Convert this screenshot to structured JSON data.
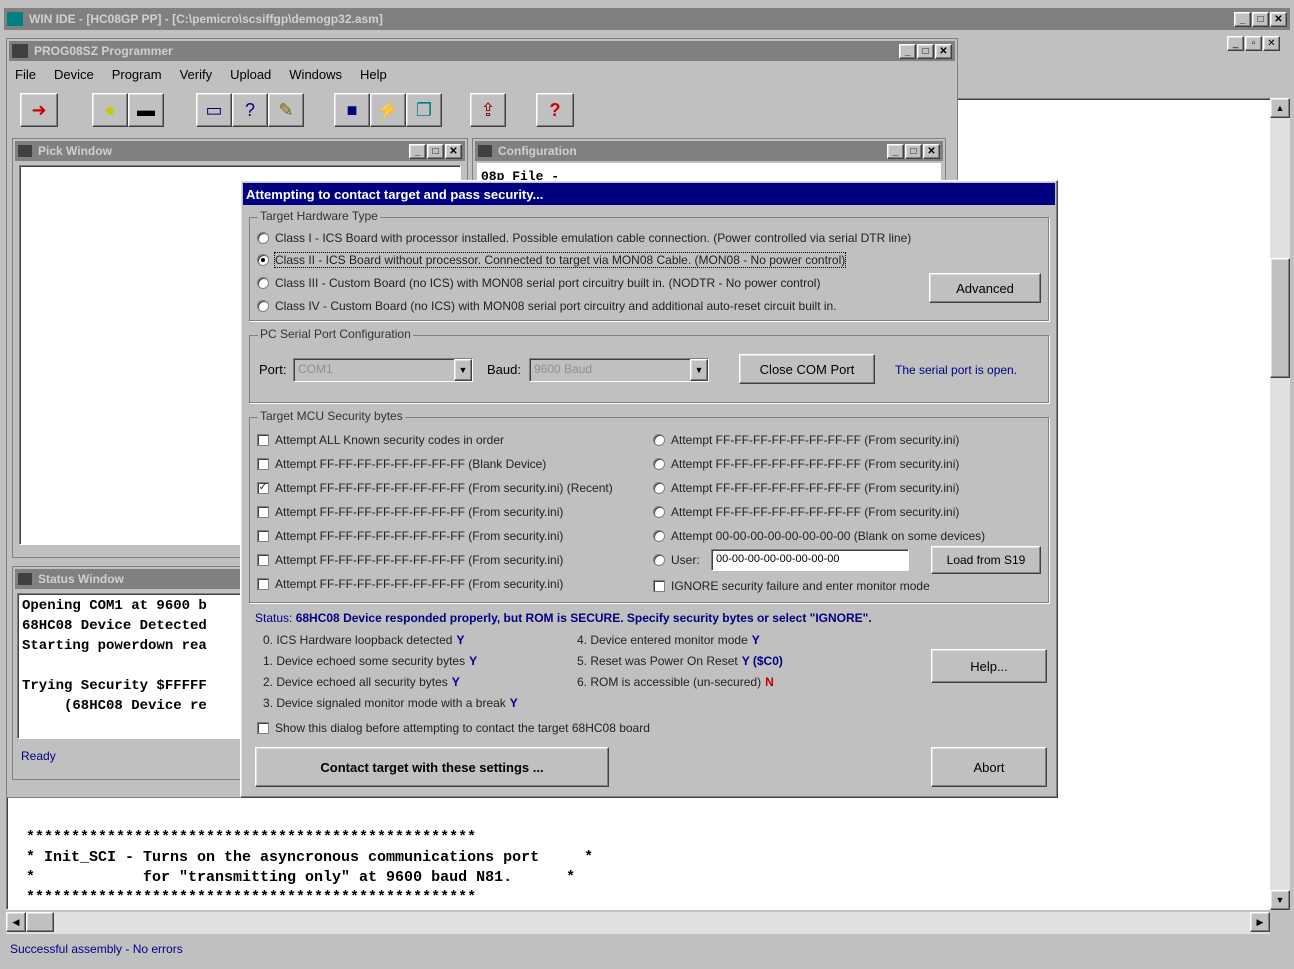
{
  "ide": {
    "title": "WIN IDE - [HC08GP PP] - [C:\\pemicro\\scsiffgp\\demogp32.asm]",
    "ctl": [
      "_",
      "□",
      "✕"
    ],
    "ctl2": [
      "_",
      "▫",
      "✕"
    ]
  },
  "prog": {
    "title": "PROG08SZ Programmer",
    "ctl": [
      "_",
      "□",
      "✕"
    ],
    "menu": [
      "File",
      "Device",
      "Program",
      "Verify",
      "Upload",
      "Windows",
      "Help"
    ],
    "toolbar": [
      {
        "icon": "arrow-icon",
        "glyph": "➜",
        "color": "#cc0000"
      },
      {
        "icon": "bulb-icon",
        "glyph": "💡",
        "color": "#cccc00"
      },
      {
        "icon": "chip-icon",
        "glyph": "▬",
        "color": "#000000"
      },
      {
        "icon": "monitor-icon",
        "glyph": "▭",
        "color": "#000080"
      },
      {
        "icon": "window-help-icon",
        "glyph": "?",
        "color": "#000080"
      },
      {
        "icon": "pencil-icon",
        "glyph": "✎",
        "color": "#806000"
      },
      {
        "icon": "save-icon",
        "glyph": "■",
        "color": "#000080"
      },
      {
        "icon": "program-icon",
        "glyph": "⚡",
        "color": "#808000"
      },
      {
        "icon": "copy-icon",
        "glyph": "❐",
        "color": "#008080"
      },
      {
        "icon": "upload-icon",
        "glyph": "⇪",
        "color": "#800000"
      },
      {
        "icon": "help-icon",
        "glyph": "?",
        "color": "#cc0000"
      }
    ]
  },
  "pick": {
    "title": "Pick Window",
    "ctl": [
      "_",
      "□",
      "✕"
    ]
  },
  "config": {
    "title": "Configuration",
    "ctl": [
      "_",
      "□",
      "✕"
    ],
    "text": "08p File -"
  },
  "status_win": {
    "title": "Status Window",
    "lines": [
      "Opening COM1 at 9600 b",
      "68HC08 Device Detected",
      "Starting powerdown rea",
      "",
      "Trying Security $FFFFF",
      "     (68HC08 Device re"
    ],
    "ready": "Ready"
  },
  "code": {
    "lines": [
      "**************************************************",
      "* Init_SCI - Turns on the asyncronous communications port     *",
      "*            for \"transmitting only\" at 9600 baud N81.      *",
      "**************************************************"
    ]
  },
  "ide_status": "Successful assembly - No errors",
  "dialog": {
    "title": "Attempting to contact target and pass security...",
    "hw_group": "Target Hardware Type",
    "hw_options": [
      {
        "label": "Class I - ICS Board with processor installed. Possible emulation cable connection. (Power controlled via serial DTR line)",
        "selected": false
      },
      {
        "label": "Class II - ICS Board without processor. Connected to target via MON08 Cable. (MON08 - No power control)",
        "selected": true
      },
      {
        "label": "Class III - Custom Board (no ICS) with MON08 serial port circuitry built in. (NODTR - No power control)",
        "selected": false
      },
      {
        "label": "Class IV - Custom Board (no ICS) with MON08 serial port circuitry and additional auto-reset circuit built in.",
        "selected": false
      }
    ],
    "advanced": "Advanced",
    "pc_group": "PC Serial Port Configuration",
    "port_label": "Port:",
    "port_value": "COM1",
    "baud_label": "Baud:",
    "baud_value": "9600 Baud",
    "close_port": "Close COM Port",
    "port_status": "The serial port is open.",
    "mcu_group": "Target MCU Security bytes",
    "sec_left": [
      {
        "label": "Attempt ALL Known security codes in order",
        "checked": false
      },
      {
        "label": "Attempt FF-FF-FF-FF-FF-FF-FF-FF (Blank Device)",
        "checked": false
      },
      {
        "label": "Attempt FF-FF-FF-FF-FF-FF-FF-FF (From security.ini) (Recent)",
        "checked": true
      },
      {
        "label": "Attempt FF-FF-FF-FF-FF-FF-FF-FF (From security.ini)",
        "checked": false
      },
      {
        "label": "Attempt FF-FF-FF-FF-FF-FF-FF-FF (From security.ini)",
        "checked": false
      },
      {
        "label": "Attempt FF-FF-FF-FF-FF-FF-FF-FF (From security.ini)",
        "checked": false
      },
      {
        "label": "Attempt FF-FF-FF-FF-FF-FF-FF-FF (From security.ini)",
        "checked": false
      }
    ],
    "sec_right": [
      {
        "label": "Attempt FF-FF-FF-FF-FF-FF-FF-FF (From security.ini)",
        "checked": false
      },
      {
        "label": "Attempt FF-FF-FF-FF-FF-FF-FF-FF (From security.ini)",
        "checked": false
      },
      {
        "label": "Attempt FF-FF-FF-FF-FF-FF-FF-FF (From security.ini)",
        "checked": false
      },
      {
        "label": "Attempt FF-FF-FF-FF-FF-FF-FF-FF (From security.ini)",
        "checked": false
      },
      {
        "label": "Attempt 00-00-00-00-00-00-00-00 (Blank on some devices)",
        "checked": false
      }
    ],
    "user_label": "User:",
    "user_value": "00-00-00-00-00-00-00-00",
    "load_s19": "Load from S19",
    "ignore": "IGNORE security failure and enter monitor mode",
    "status_label": "Status:",
    "status_text": "68HC08 Device responded properly, but ROM is SECURE. Specify security bytes or select \"IGNORE\".",
    "diag_left": [
      {
        "text": "0. ICS Hardware loopback detected",
        "v": "Y",
        "ok": true
      },
      {
        "text": "1. Device echoed some security bytes",
        "v": "Y",
        "ok": true
      },
      {
        "text": "2. Device echoed all security bytes",
        "v": "Y",
        "ok": true
      },
      {
        "text": "3. Device signaled monitor mode with a break",
        "v": "Y",
        "ok": true
      }
    ],
    "diag_right": [
      {
        "text": "4. Device entered monitor mode",
        "v": "Y",
        "ok": true
      },
      {
        "text": "5. Reset was Power On Reset",
        "v": "Y ($C0)",
        "ok": true
      },
      {
        "text": "6. ROM is accessible (un-secured)",
        "v": "N",
        "ok": false
      }
    ],
    "help": "Help...",
    "show_dialog": "Show this dialog before attempting to contact the target 68HC08 board",
    "contact": "Contact target with these settings ...",
    "abort": "Abort"
  }
}
